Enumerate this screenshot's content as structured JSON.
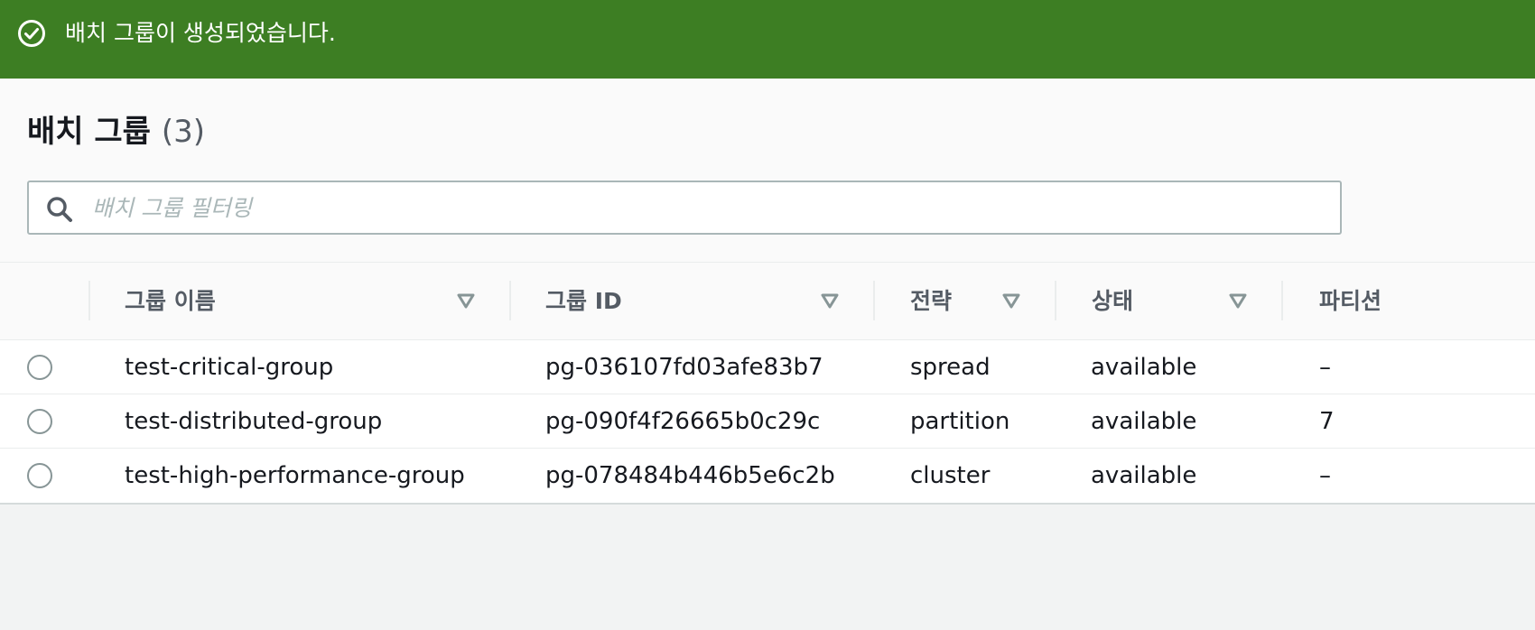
{
  "flash": {
    "message": "배치 그룹이 생성되었습니다.",
    "icon": "check-circle-icon",
    "color": "#3d7e23"
  },
  "panel": {
    "title": "배치 그룹",
    "count": "(3)"
  },
  "filter": {
    "placeholder": "배치 그룹 필터링",
    "value": ""
  },
  "table": {
    "columns": [
      "그룹 이름",
      "그룹 ID",
      "전략",
      "상태",
      "파티션"
    ],
    "rows": [
      {
        "name": "test-critical-group",
        "id": "pg-036107fd03afe83b7",
        "strategy": "spread",
        "state": "available",
        "partitions": "–"
      },
      {
        "name": "test-distributed-group",
        "id": "pg-090f4f26665b0c29c",
        "strategy": "partition",
        "state": "available",
        "partitions": "7"
      },
      {
        "name": "test-high-performance-group",
        "id": "pg-078484b446b5e6c2b",
        "strategy": "cluster",
        "state": "available",
        "partitions": "–"
      }
    ]
  }
}
